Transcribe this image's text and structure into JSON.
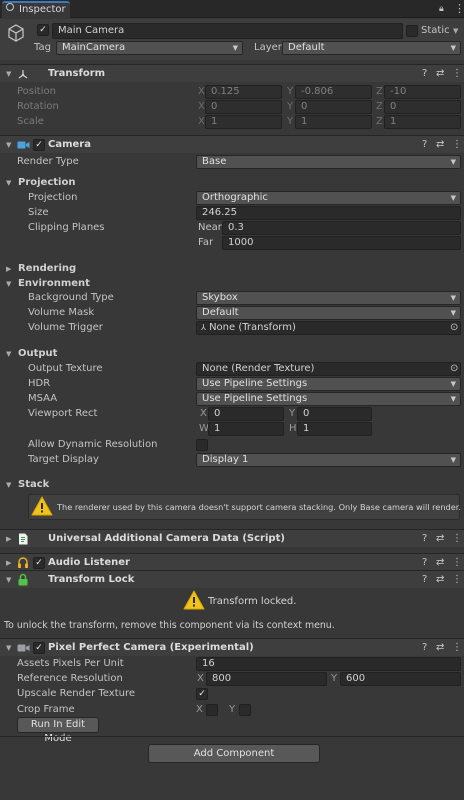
{
  "tab": {
    "label": "Inspector"
  },
  "header": {
    "object_name": "Main Camera",
    "static_label": "Static",
    "tag_label": "Tag",
    "tag_value": "MainCamera",
    "layer_label": "Layer",
    "layer_value": "Default"
  },
  "transform": {
    "title": "Transform",
    "position_label": "Position",
    "rotation_label": "Rotation",
    "scale_label": "Scale",
    "position": {
      "x": "0.125",
      "y": "-0.806",
      "z": "-10"
    },
    "rotation": {
      "x": "0",
      "y": "0",
      "z": "0"
    },
    "scale": {
      "x": "1",
      "y": "1",
      "z": "1"
    }
  },
  "axes": {
    "x": "X",
    "y": "Y",
    "z": "Z",
    "w": "W",
    "h": "H"
  },
  "camera": {
    "title": "Camera",
    "render_type_label": "Render Type",
    "render_type": "Base",
    "projection_section": "Projection",
    "projection_label": "Projection",
    "projection_value": "Orthographic",
    "size_label": "Size",
    "size_value": "246.25",
    "clipping_label": "Clipping Planes",
    "near_label": "Near",
    "near_value": "0.3",
    "far_label": "Far",
    "far_value": "1000",
    "rendering_section": "Rendering",
    "environment_section": "Environment",
    "background_type_label": "Background Type",
    "background_type": "Skybox",
    "volume_mask_label": "Volume Mask",
    "volume_mask": "Default",
    "volume_trigger_label": "Volume Trigger",
    "volume_trigger": "None (Transform)",
    "output_section": "Output",
    "output_texture_label": "Output Texture",
    "output_texture": "None (Render Texture)",
    "hdr_label": "HDR",
    "hdr_value": "Use Pipeline Settings",
    "msaa_label": "MSAA",
    "msaa_value": "Use Pipeline Settings",
    "viewport_label": "Viewport Rect",
    "viewport": {
      "x": "0",
      "y": "0",
      "w": "1",
      "h": "1"
    },
    "allow_dynamic_label": "Allow Dynamic Resolution",
    "target_display_label": "Target Display",
    "target_display": "Display 1",
    "stack_section": "Stack",
    "stack_warning": "The renderer used by this camera doesn't support camera stacking. Only Base camera will render."
  },
  "uacd": {
    "title": "Universal Additional Camera Data (Script)"
  },
  "audio": {
    "title": "Audio Listener"
  },
  "transform_lock": {
    "title": "Transform Lock",
    "locked_text": "Transform locked.",
    "info_text": "To unlock the transform, remove this component via its context menu."
  },
  "ppc": {
    "title": "Pixel Perfect Camera (Experimental)",
    "assets_ppu_label": "Assets Pixels Per Unit",
    "assets_ppu": "16",
    "ref_res_label": "Reference Resolution",
    "ref_x": "800",
    "ref_y": "600",
    "upscale_label": "Upscale Render Texture",
    "crop_label": "Crop Frame",
    "run_button": "Run In Edit Mode"
  },
  "add_component": "Add Component",
  "icons": {
    "check": "✓",
    "help": "?",
    "presets": "⇄",
    "menu": "⋮",
    "lock": "🔒",
    "target": "⊙"
  }
}
